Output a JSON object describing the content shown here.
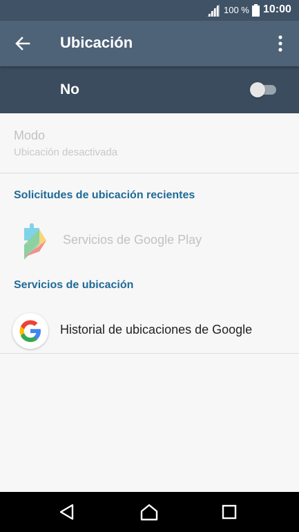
{
  "status_bar": {
    "battery_text": "100 %",
    "time": "10:00",
    "signal_icon": "signal-icon",
    "battery_icon": "battery-icon"
  },
  "app_bar": {
    "title": "Ubicación",
    "back_icon": "arrow-back-icon",
    "menu_icon": "more-vert-icon"
  },
  "master_switch": {
    "label": "No",
    "on": false
  },
  "mode": {
    "title": "Modo",
    "subtitle": "Ubicación desactivada"
  },
  "recent_requests": {
    "header": "Solicitudes de ubicación recientes",
    "items": [
      {
        "label": "Servicios de Google Play",
        "icon": "google-play-services-icon"
      }
    ]
  },
  "location_services": {
    "header": "Servicios de ubicación",
    "items": [
      {
        "label": "Historial de ubicaciones de Google",
        "icon": "google-icon"
      }
    ]
  },
  "nav_bar": {
    "back_icon": "nav-back-icon",
    "home_icon": "nav-home-icon",
    "recent_icon": "nav-recent-icon"
  },
  "colors": {
    "status_bar": "#3f5266",
    "app_bar": "#4e6278",
    "switch_bar": "#3a4c5e",
    "accent": "#1f6a97",
    "background": "#f7f7f7"
  }
}
